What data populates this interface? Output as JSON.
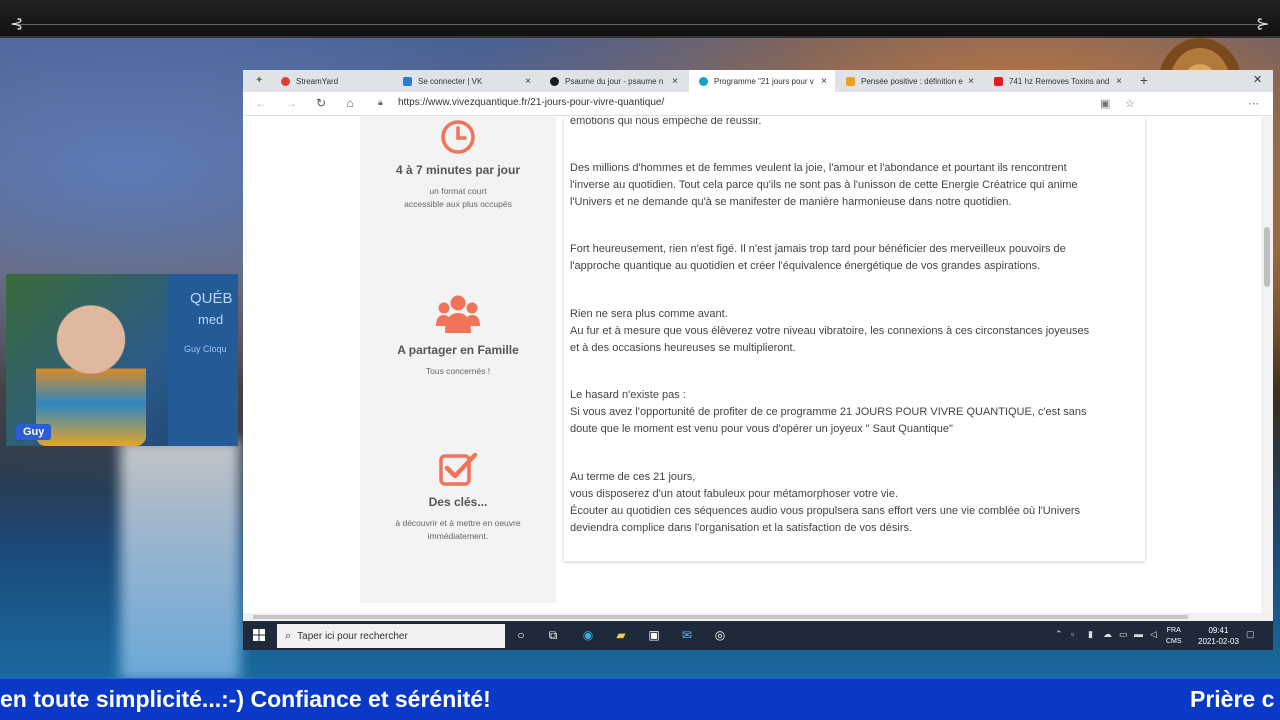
{
  "stream": {
    "webcam_name": "Guy",
    "banner_line1": "QUÉB",
    "banner_line2": "med",
    "banner_line3": "Guy Cloqu",
    "ticker_text": "en toute simplicité...:-) Confiance et sérénité!",
    "ticker_next": "Prière c"
  },
  "browser": {
    "tabs": [
      {
        "label": "StreamYard",
        "color": "#e63a2e"
      },
      {
        "label": "Se connecter | VK",
        "color": "#2a7bd5"
      },
      {
        "label": "Psaume du jour - psaume n",
        "color": "#1a1a1a"
      },
      {
        "label": "Programme \"21 jours pour v",
        "color": "#1aa1c8"
      },
      {
        "label": "Pensée positive : définition e",
        "color": "#f0a020"
      },
      {
        "label": "741 hz Removes Toxins and",
        "color": "#e02020"
      }
    ],
    "url": "https://www.vivezquantique.fr/21-jours-pour-vivre-quantique/"
  },
  "features": [
    {
      "icon": "clock-icon",
      "title": "4 à 7 minutes par jour",
      "desc1": "un format court",
      "desc2": "accessible aux plus occupés"
    },
    {
      "icon": "group-icon",
      "title": "A partager en Famille",
      "desc1": "Tous concernés !",
      "desc2": ""
    },
    {
      "icon": "checkbox-icon",
      "title": "Des clés...",
      "desc1": "à découvrir et à mettre en oeuvre",
      "desc2": "immédiatement."
    }
  ],
  "content": {
    "p0": [
      "émotions qui nous empêche de réussir."
    ],
    "p1": [
      "Des millions d'hommes et de femmes veulent  la joie, l'amour et l'abondance et pourtant ils rencontrent",
      "l'inverse au quotidien.  Tout cela parce qu'ils ne sont pas à l'unisson de cette Energie Créatrice qui anime",
      "l'Univers et ne demande qu'à se manifester de manière harmonieuse dans notre quotidien."
    ],
    "p2": [
      "Fort heureusement, rien n'est figé. Il n'est jamais trop tard pour bénéficier des merveilleux pouvoirs de",
      "l'approche quantique au quotidien et créer l'équivalence énergétique de vos grandes aspirations."
    ],
    "p3": [
      "Rien ne sera plus comme avant.",
      "Au fur et à mesure que vous élèverez votre niveau vibratoire, les connexions à ces circonstances joyeuses",
      "et à des occasions heureuses se multiplieront."
    ],
    "p4": [
      "Le hasard n'existe pas :",
      "Si vous avez l'opportunité de profiter de ce programme 21 JOURS POUR VIVRE QUANTIQUE, c'est sans",
      "doute que le moment est venu pour vous d'opérer un joyeux \" Saut Quantique\""
    ],
    "p5": [
      "Au terme de ces 21 jours,",
      "vous disposerez d'un atout fabuleux pour métamorphoser votre vie.",
      "Écouter au quotidien ces séquences audio vous propulsera sans effort vers une vie comblée où l'Univers",
      "deviendra complice dans l'organisation et la satisfaction de vos désirs."
    ]
  },
  "taskbar": {
    "search_placeholder": "Taper ici pour rechercher",
    "lang1": "FRA",
    "lang2": "CMS",
    "time": "09:41",
    "date": "2021-02-03"
  },
  "colors": {
    "accent_icon": "#f0735a",
    "ticker_bg": "#0a39c7"
  }
}
